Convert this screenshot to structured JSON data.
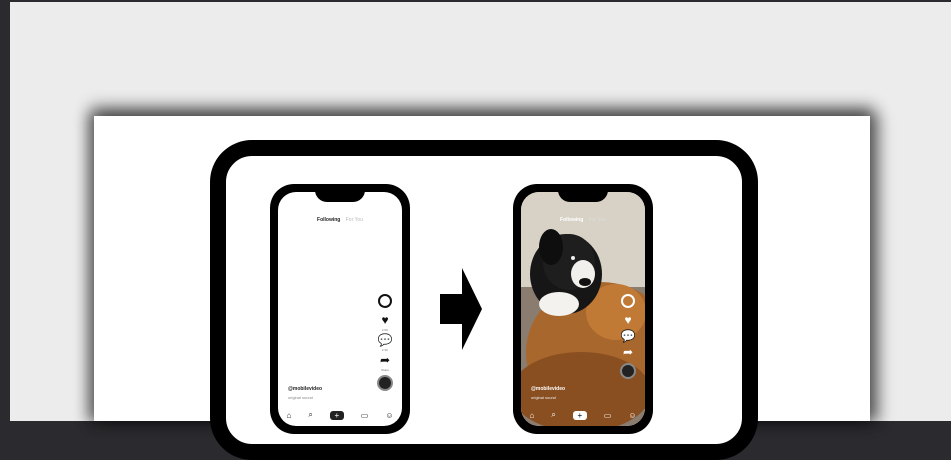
{
  "feed_tabs": {
    "following": "Following",
    "for_you": "For You"
  },
  "phone_before": {
    "username": "@mobilevideo",
    "sound": "original sound",
    "rail_captions": [
      "4.5K",
      "2.3K",
      "Share"
    ]
  },
  "phone_after": {
    "username": "@mobilevideo",
    "sound": "original sound"
  },
  "icons": [
    "profile-icon",
    "heart-icon",
    "comment-icon",
    "share-icon",
    "music-disc-icon",
    "home-icon",
    "search-icon",
    "plus-icon",
    "inbox-icon",
    "me-icon",
    "right-arrow-icon"
  ],
  "colors": {
    "viewer_bg": "#ececec",
    "outer_bg": "#2b2b2f",
    "frame": "#000000",
    "page": "#ffffff"
  }
}
